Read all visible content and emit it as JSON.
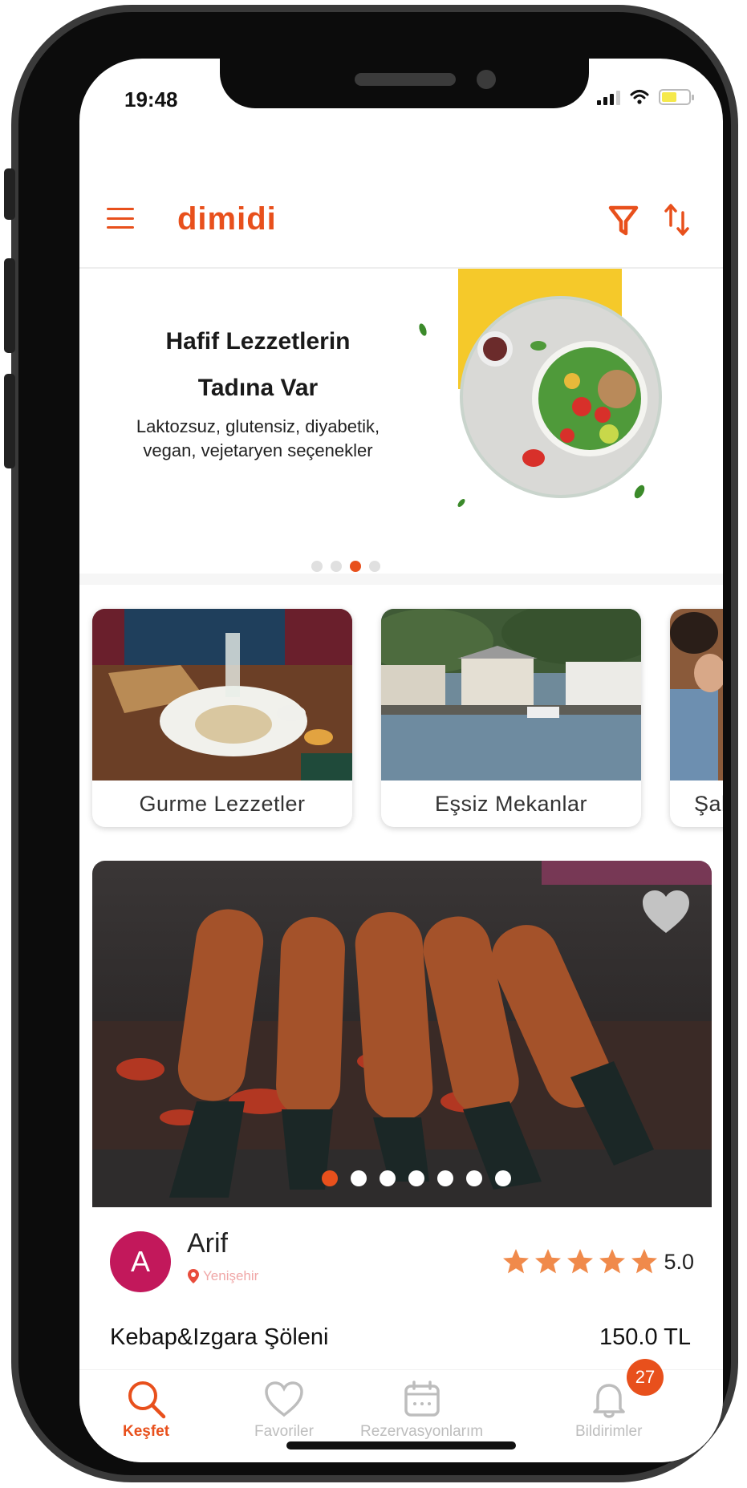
{
  "status_bar": {
    "time": "19:48"
  },
  "app": {
    "logo": "dimidi"
  },
  "hero": {
    "title_line1": "Hafif Lezzetlerin",
    "title_line2": "Tadına Var",
    "subtitle_line1": "Laktozsuz, glutensiz, diyabetik,",
    "subtitle_line2": "vegan, vejetaryen seçenekler",
    "slide_count": 4,
    "active_slide": 3
  },
  "categories": [
    {
      "label": "Gurme  Lezzetler"
    },
    {
      "label": "Eşsiz  Mekanlar"
    },
    {
      "label": "Şah"
    }
  ],
  "product": {
    "image_count": 7,
    "active_image": 1,
    "vendor_initial": "A",
    "vendor_name": "Arif",
    "vendor_location": "Yenişehir",
    "rating": "5.0",
    "star_count": 5,
    "name": "Kebap&Izgara Şöleni",
    "price": "150.0 TL"
  },
  "bottom_nav": {
    "items": [
      {
        "label": "Keşfet",
        "icon": "search-icon",
        "active": true
      },
      {
        "label": "Favoriler",
        "icon": "heart-icon",
        "active": false
      },
      {
        "label": "Rezervasyonlarım",
        "icon": "calendar-icon",
        "active": false
      },
      {
        "label": "Bildirimler",
        "icon": "bell-icon",
        "active": false
      }
    ],
    "notification_count": "27"
  },
  "colors": {
    "accent": "#e8501c",
    "avatar": "#c2185b",
    "star": "#f08a4b",
    "inactive": "#bdbdbd"
  }
}
